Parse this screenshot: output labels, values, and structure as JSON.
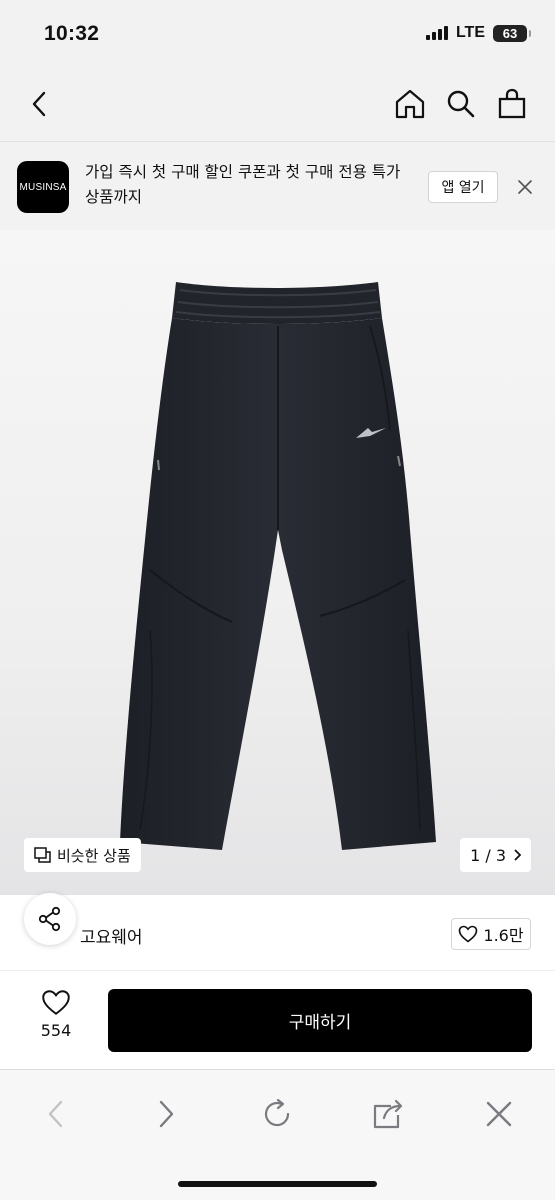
{
  "status_bar": {
    "time": "10:32",
    "network": "LTE",
    "battery": "63"
  },
  "nav": {
    "back_icon": "chevron-left-icon",
    "home_icon": "home-icon",
    "search_icon": "search-icon",
    "cart_icon": "shopping-bag-icon"
  },
  "app_banner": {
    "logo_text": "MUSINSA",
    "message": "가입 즉시 첫 구매 할인 쿠폰과 첫 구매 전용 특가 상품까지",
    "open_label": "앱 열기",
    "close_icon": "close-icon"
  },
  "product": {
    "similar_label": "비슷한 상품",
    "page_indicator": "1 / 3",
    "image_colors": {
      "background": "#f1f1f1",
      "product": "#23252d"
    }
  },
  "shop": {
    "name": "고요웨어",
    "like_count": "1.6만"
  },
  "purchase": {
    "wish_count": "554",
    "buy_label": "구매하기"
  },
  "browser": {
    "icons": [
      "back-icon",
      "forward-icon",
      "reload-icon",
      "share-icon",
      "close-icon"
    ]
  }
}
